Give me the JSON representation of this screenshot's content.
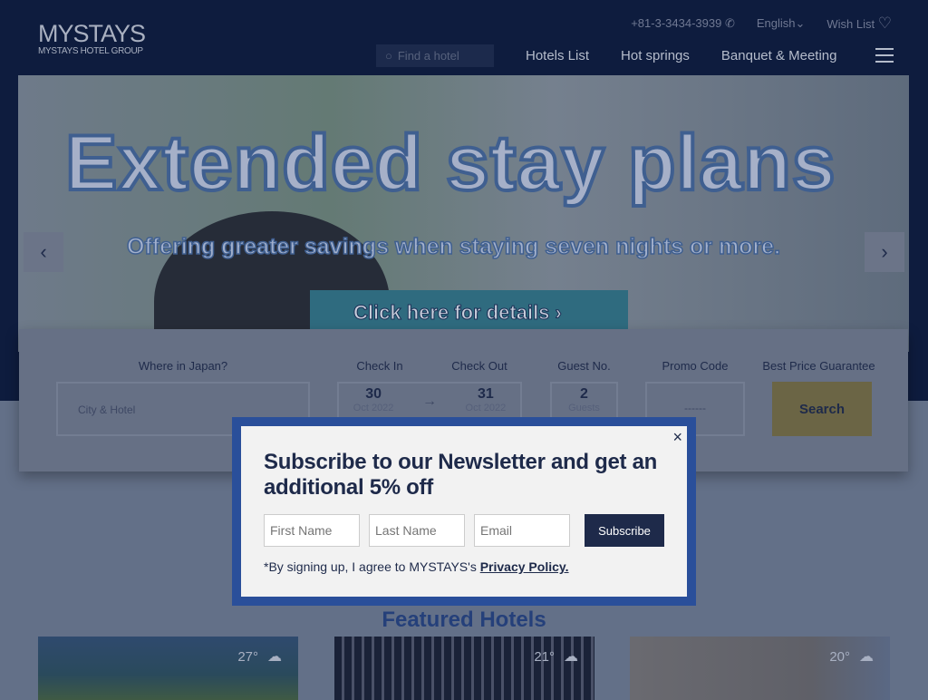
{
  "header": {
    "logo": "MYSTAYS",
    "logo_sub": "MYSTAYS HOTEL GROUP",
    "phone": "+81-3-3434-3939",
    "language": "English",
    "wishlist": "Wish List",
    "search_placeholder": "Find a hotel",
    "nav": [
      "Hotels List",
      "Hot springs",
      "Banquet & Meeting"
    ]
  },
  "banner": {
    "title": "Extended stay plans",
    "subtitle": "Offering greater savings when staying seven nights or more.",
    "cta": "Click here for details"
  },
  "booking": {
    "where_label": "Where in Japan?",
    "where_placeholder": "City & Hotel",
    "checkin_label": "Check In",
    "checkout_label": "Check Out",
    "checkin_day": "30",
    "checkin_month": "Oct 2022",
    "checkout_day": "31",
    "checkout_month": "Oct 2022",
    "guest_label": "Guest No.",
    "guests": "2",
    "guests_unit": "Guests",
    "promo_label": "Promo Code",
    "promo_value": "------",
    "best_price": "Best Price Guarantee",
    "search": "Search"
  },
  "featured": {
    "title": "Featured Hotels",
    "cards": [
      {
        "temp": "27°",
        "weather": "partly-cloudy-icon",
        "color": "#3f7ab0"
      },
      {
        "temp": "21°",
        "weather": "rain-icon",
        "color": "#1d2f8a"
      },
      {
        "temp": "20°",
        "weather": "rain-icon",
        "color": "#c9bfb0"
      }
    ]
  },
  "popup": {
    "title": "Subscribe to our Newsletter and get an additional 5% off",
    "first_name": "First Name",
    "last_name": "Last Name",
    "email": "Email",
    "subscribe": "Subscribe",
    "terms": "*By signing up, I agree to MYSTAYS's ",
    "privacy": "Privacy Policy.",
    "close": "×"
  }
}
